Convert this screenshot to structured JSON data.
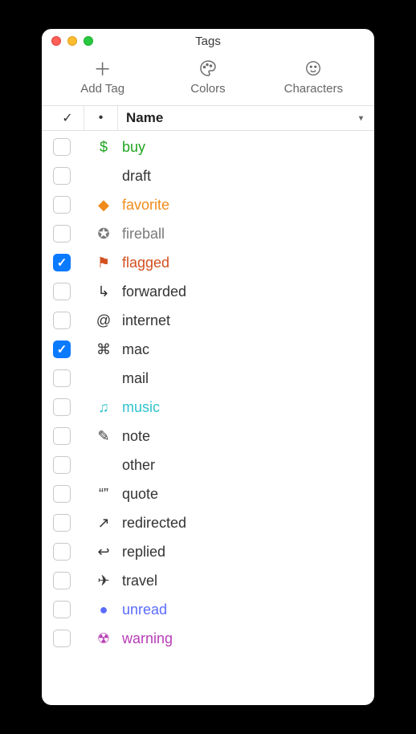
{
  "window": {
    "title": "Tags"
  },
  "toolbar": {
    "add_tag": {
      "label": "Add Tag"
    },
    "colors": {
      "label": "Colors"
    },
    "characters": {
      "label": "Characters"
    }
  },
  "columns": {
    "check": "✓",
    "dot": "•",
    "name": "Name"
  },
  "tags": [
    {
      "checked": false,
      "icon": "$",
      "icon_name": "dollar-icon",
      "name": "buy",
      "color": "#1fa61f"
    },
    {
      "checked": false,
      "icon": "",
      "icon_name": "",
      "name": "draft",
      "color": "#333"
    },
    {
      "checked": false,
      "icon": "◆",
      "icon_name": "diamond-icon",
      "name": "favorite",
      "color": "#ef8b1a"
    },
    {
      "checked": false,
      "icon": "✪",
      "icon_name": "star-badge-icon",
      "name": "fireball",
      "color": "#7a7a7a"
    },
    {
      "checked": true,
      "icon": "⚑",
      "icon_name": "flag-icon",
      "name": "flagged",
      "color": "#d35020"
    },
    {
      "checked": false,
      "icon": "↳",
      "icon_name": "forward-arrow-icon",
      "name": "forwarded",
      "color": "#333"
    },
    {
      "checked": false,
      "icon": "@",
      "icon_name": "at-icon",
      "name": "internet",
      "color": "#333"
    },
    {
      "checked": true,
      "icon": "⌘",
      "icon_name": "command-icon",
      "name": "mac",
      "color": "#333"
    },
    {
      "checked": false,
      "icon": "",
      "icon_name": "",
      "name": "mail",
      "color": "#333"
    },
    {
      "checked": false,
      "icon": "♫",
      "icon_name": "music-icon",
      "name": "music",
      "color": "#2fc2cc"
    },
    {
      "checked": false,
      "icon": "✎",
      "icon_name": "pencil-icon",
      "name": "note",
      "color": "#333"
    },
    {
      "checked": false,
      "icon": "",
      "icon_name": "",
      "name": "other",
      "color": "#333"
    },
    {
      "checked": false,
      "icon": "“”",
      "icon_name": "quote-icon",
      "name": "quote",
      "color": "#333"
    },
    {
      "checked": false,
      "icon": "↗",
      "icon_name": "redirect-arrow-icon",
      "name": "redirected",
      "color": "#333"
    },
    {
      "checked": false,
      "icon": "↩",
      "icon_name": "reply-arrow-icon",
      "name": "replied",
      "color": "#333"
    },
    {
      "checked": false,
      "icon": "✈",
      "icon_name": "airplane-icon",
      "name": "travel",
      "color": "#333"
    },
    {
      "checked": false,
      "icon": "●",
      "icon_name": "dot-icon",
      "name": "unread",
      "color": "#5a6bff"
    },
    {
      "checked": false,
      "icon": "☢",
      "icon_name": "radiation-icon",
      "name": "warning",
      "color": "#b73db7"
    }
  ]
}
